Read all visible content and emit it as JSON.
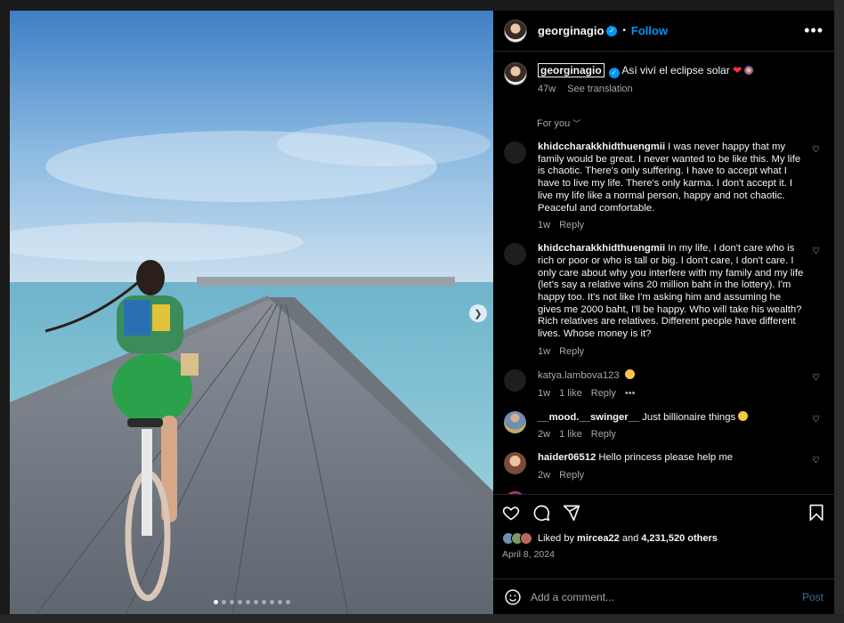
{
  "post": {
    "username": "georginagio",
    "follow_label": "Follow",
    "more_label": "•••",
    "caption": "Así viví el eclipse solar",
    "caption_age": "47w",
    "see_translation": "See translation",
    "sort_label": "For you"
  },
  "comments": [
    {
      "user": "khidccharakkhidthuengmii",
      "text": "I was never happy that my family would be great. I never wanted to be like this. My life is chaotic. There's only suffering. I have to accept what I have to live my life. There's only karma. I don't accept it. I live my life like a normal person, happy and not chaotic. Peaceful and comfortable.",
      "age": "1w",
      "reply": "Reply"
    },
    {
      "user": "khidccharakkhidthuengmii",
      "text": "In my life, I don't care who is rich or poor or who is tall or big. I don't care, I don't care. I only care about why you interfere with my family and my life (let's say a relative wins 20 million baht in the lottery). I'm happy too. It's not like I'm asking him and assuming he gives me 2000 baht, I'll be happy. Who will take his wealth? Rich relatives are relatives. Different people have different lives. Whose money is it?",
      "age": "1w",
      "reply": "Reply"
    },
    {
      "user": "katya.lambova123",
      "text": "",
      "age": "1w",
      "likes": "1 like",
      "reply": "Reply",
      "more": "•••"
    },
    {
      "user": "__mood.__swinger__",
      "text": "Just billionaire things",
      "age": "2w",
      "likes": "1 like",
      "reply": "Reply"
    },
    {
      "user": "haider06512",
      "text": "Hello princess please help me",
      "age": "2w",
      "reply": "Reply"
    }
  ],
  "likes": {
    "prefix": "Liked by",
    "user": "mircea22",
    "middle": "and",
    "others": "4,231,520 others"
  },
  "date": "April 8, 2024",
  "add_comment": {
    "placeholder": "Add a comment...",
    "post_label": "Post"
  },
  "carousel": {
    "slides": 10,
    "active_index": 0
  },
  "colors": {
    "accent": "#0095f6",
    "background": "#000000",
    "muted": "#a8a8a8"
  },
  "icons": [
    "verified-badge-icon",
    "more-options-icon",
    "heart-icon",
    "comment-icon",
    "share-icon",
    "bookmark-icon",
    "emoji-icon",
    "chevron-right-icon",
    "chevron-down-icon"
  ]
}
